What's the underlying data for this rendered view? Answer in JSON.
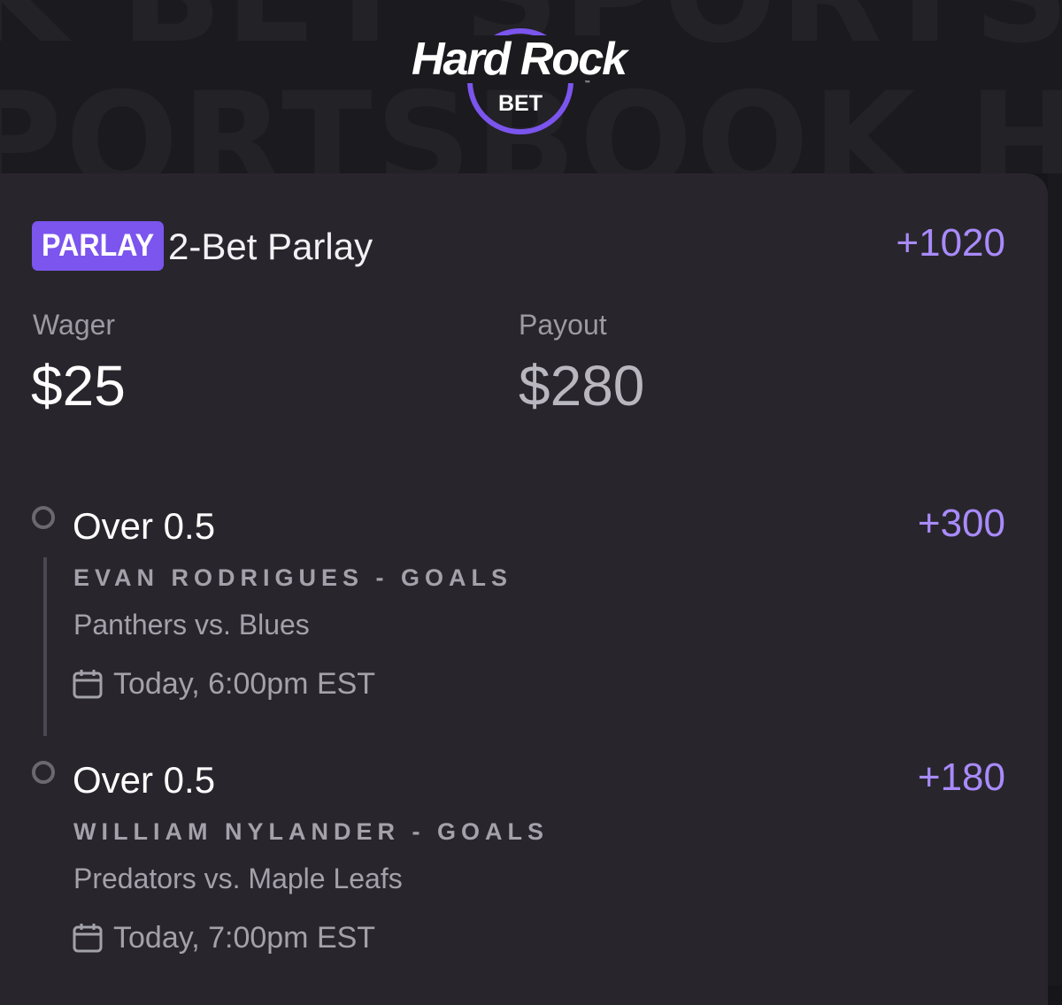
{
  "brand": {
    "name": "Hard Rock",
    "sub": "BET",
    "trademark": "™",
    "background_text_row1": "K BET SPORTSBOOK HARD ROCK",
    "background_text_row2": "PORTSBOOK HARD ROCK BET",
    "ring_color": "#7b55ee"
  },
  "bet": {
    "tag": "PARLAY",
    "title": "2-Bet Parlay",
    "odds": "+1020",
    "wager_label": "Wager",
    "wager_amount": "$25",
    "payout_label": "Payout",
    "payout_amount": "$280"
  },
  "legs": [
    {
      "selection": "Over 0.5",
      "odds": "+300",
      "market": "EVAN RODRIGUES - GOALS",
      "matchup": "Panthers vs. Blues",
      "time": "Today, 6:00pm EST",
      "icon": "calendar-icon"
    },
    {
      "selection": "Over 0.5",
      "odds": "+180",
      "market": "WILLIAM NYLANDER - GOALS",
      "matchup": "Predators vs. Maple Leafs",
      "time": "Today, 7:00pm EST",
      "icon": "calendar-icon"
    }
  ],
  "colors": {
    "accent": "#7b55ee",
    "odds": "#a98bfc",
    "card_background": "#28262c",
    "page_background": "#161519"
  }
}
